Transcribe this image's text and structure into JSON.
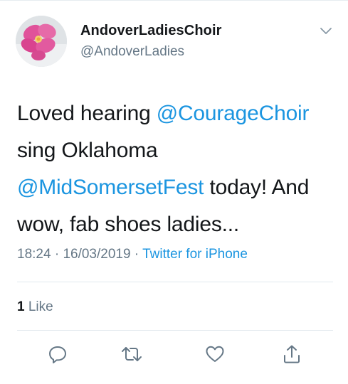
{
  "author": {
    "display_name": "AndoverLadiesChoir",
    "handle": "@AndoverLadies",
    "avatar_icon": "pink-flower-avatar"
  },
  "tweet": {
    "text_before_mention_1": "Loved hearing ",
    "mention_1": "@CourageChoir",
    "text_between": " sing Oklahoma ",
    "mention_2": "@MidSomersetFest",
    "text_after": " today! And wow, fab shoes ladies..."
  },
  "meta": {
    "time": "18:24",
    "separator": " · ",
    "date": "16/03/2019",
    "source": "Twitter for iPhone"
  },
  "stats": {
    "like_count": "1",
    "like_label": " Like"
  },
  "actions": {
    "reply_icon": "reply-icon",
    "retweet_icon": "retweet-icon",
    "like_icon": "heart-icon",
    "share_icon": "share-icon"
  },
  "colors": {
    "link": "#1b95e0",
    "secondary_text": "#657786",
    "primary_text": "#14171a",
    "divider": "#e1e8ed"
  }
}
